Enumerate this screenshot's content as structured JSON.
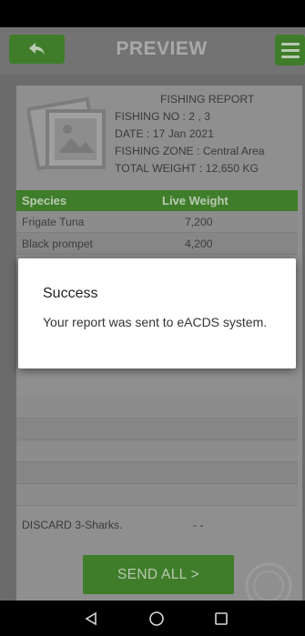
{
  "app": {
    "title": "PREVIEW"
  },
  "report": {
    "heading": "FISHING REPORT",
    "fishing_no": "FISHING NO : 2 , 3",
    "date": "DATE : 17 Jan 2021",
    "zone": "FISHING ZONE : Central Area",
    "total_weight": "TOTAL WEIGHT : 12,650 KG"
  },
  "table": {
    "headers": [
      "Species",
      "Live Weight"
    ],
    "rows": [
      {
        "species": "Frigate Tuna",
        "weight": "7,200"
      },
      {
        "species": "Black prompet",
        "weight": "4,200"
      }
    ]
  },
  "discard": {
    "label": "DISCARD 3-Sharks.",
    "value": "- -"
  },
  "send_button": "SEND ALL >",
  "dialog": {
    "title": "Success",
    "message": "Your report was sent to eACDS system."
  },
  "colors": {
    "accent_green": "#3f7d2a",
    "overlay_gray": "#6b6b6b"
  },
  "icons": [
    "back-arrow-icon",
    "menu-icon",
    "report-image-icon",
    "stamp-icon",
    "nav-back-icon",
    "nav-home-icon",
    "nav-recents-icon"
  ]
}
